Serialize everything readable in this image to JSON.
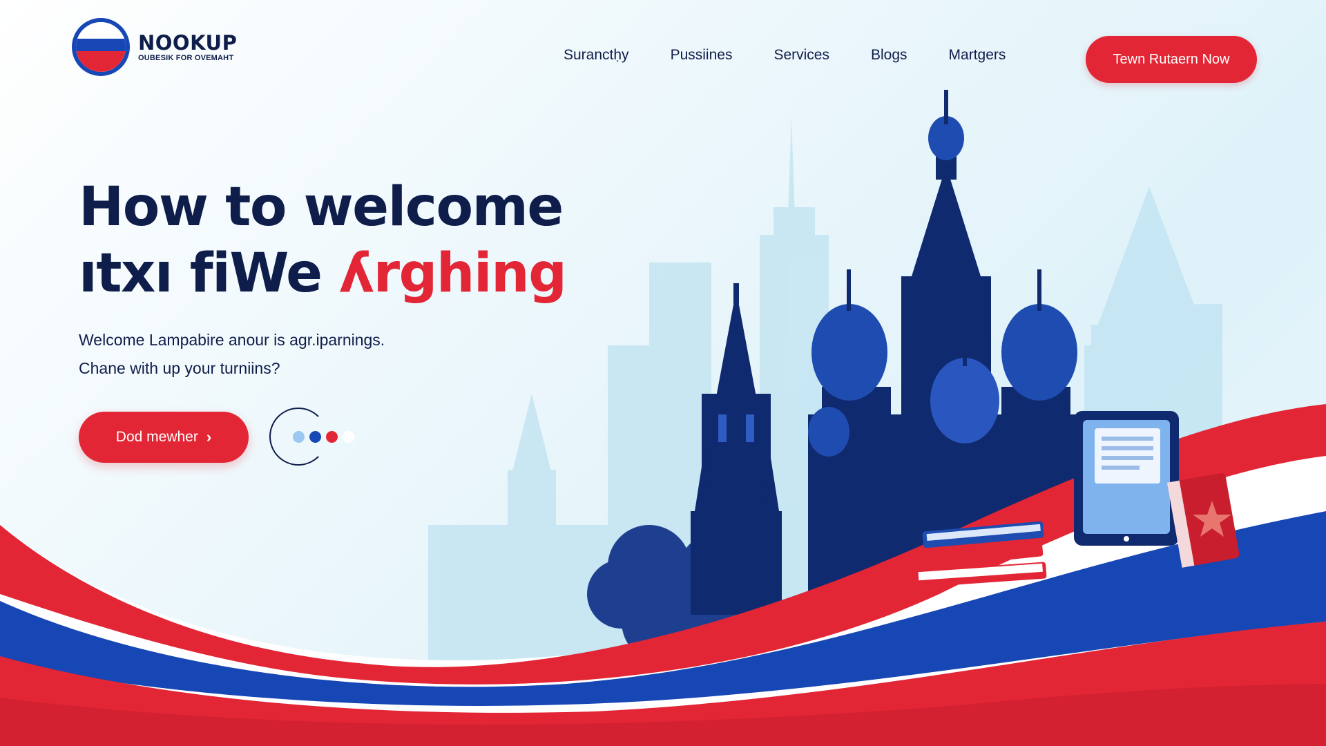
{
  "brand": {
    "name": "NOOKUP",
    "tagline": "OUBESIK FOR OVEMAHT",
    "logo_colors": [
      "#ffffff",
      "#1747b5",
      "#e32636"
    ]
  },
  "nav": {
    "items": [
      {
        "label": "Suranctḥy"
      },
      {
        "label": "Pussiines"
      },
      {
        "label": "Services"
      },
      {
        "label": "Blogs"
      },
      {
        "label": "Martgers"
      }
    ],
    "cta_label": "Tewn Rutaern Now"
  },
  "hero": {
    "title_line1": "How to welcome",
    "title_line2_dark": "ıtxı fiWe ",
    "title_line2_accent": "ʎrghing",
    "subtitle_line1": "Welcome Lampabire anour is agr.iparnings.",
    "subtitle_line2": "Chane with up your turniins?",
    "cta_label": "Dod mewher",
    "cta_icon": "chevron-right-icon",
    "carousel_dot_colors": [
      "#9cc7f0",
      "#1747b5",
      "#e32636",
      "#ffffff"
    ]
  },
  "theme": {
    "navy": "#0f1d4a",
    "blue": "#1747b5",
    "red": "#e32636",
    "sky": "#dff2f9"
  }
}
